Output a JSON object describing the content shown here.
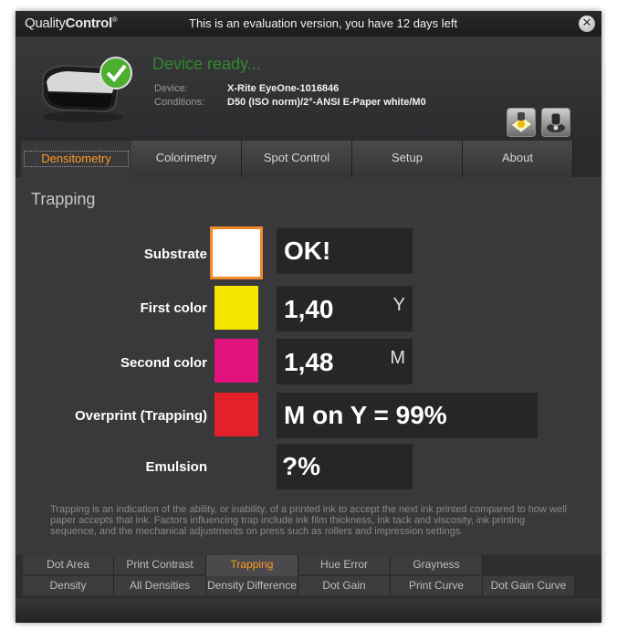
{
  "titlebar": {
    "logo_prefix": "Quality",
    "logo_bold": "Control",
    "logo_mark": "®",
    "eval_text": "This is an evaluation version, you have 12 days left",
    "close_glyph": "✕"
  },
  "device": {
    "status": "Device ready...",
    "device_label": "Device:",
    "device_value": "X-Rite EyeOne-1016846",
    "conditions_label": "Conditions:",
    "conditions_value": "D50 (ISO norm)/2°-ANSI E-Paper white/M0"
  },
  "main_tabs": [
    "Densitometry",
    "Colorimetry",
    "Spot Control",
    "Setup",
    "About"
  ],
  "section": {
    "title": "Trapping"
  },
  "rows": {
    "substrate": {
      "label": "Substrate",
      "value": "OK!",
      "color": "#ffffff"
    },
    "first": {
      "label": "First color",
      "value": "1,40",
      "unit": "Y",
      "color": "#f5e500"
    },
    "second": {
      "label": "Second color",
      "value": "1,48",
      "unit": "M",
      "color": "#e0147c"
    },
    "overprint": {
      "label": "Overprint (Trapping)",
      "value": "M on Y = 99%",
      "color": "#e3212b"
    },
    "emulsion": {
      "label": "Emulsion",
      "value": "?%"
    }
  },
  "description": "Trapping is an indication of the ability, or inability, of a printed ink to accept the next ink printed compared to how well paper accepts that ink. Factors influencing trap include ink film thickness, ink tack and viscosity, ink printing sequence, and the mechanical adjustments on press such as rollers and impression settings.",
  "sub_tabs_top": [
    "Dot Area",
    "Print Contrast",
    "Trapping",
    "Hue Error",
    "Grayness"
  ],
  "sub_tabs_bottom": [
    "Density",
    "All Densities",
    "Density Difference",
    "Dot Gain",
    "Print Curve",
    "Dot Gain Curve"
  ],
  "colors": {
    "accent": "#ff9b24",
    "ready_green": "#2f8a2c",
    "selected_border": "#f0892a"
  }
}
